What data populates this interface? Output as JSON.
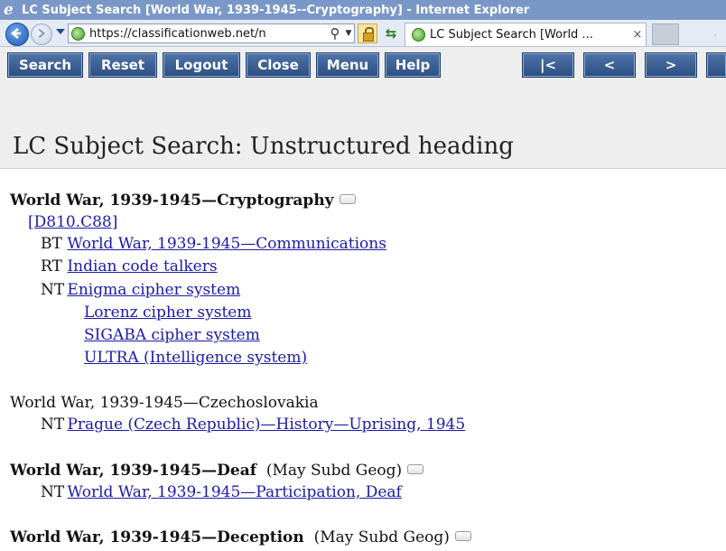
{
  "window": {
    "title": "LC Subject Search [World War, 1939-1945--Cryptography] - Internet Explorer"
  },
  "browser": {
    "url": "https://classificationweb.net/n",
    "tab_title": "LC Subject Search [World ...",
    "tab_close": "×"
  },
  "toolbar": {
    "buttons": [
      "Search",
      "Reset",
      "Logout",
      "Close",
      "Menu",
      "Help",
      "|<",
      "<",
      ">"
    ]
  },
  "page": {
    "title": "LC Subject Search: Unstructured heading"
  },
  "entries": [
    {
      "heading": "World War, 1939-1945—Cryptography",
      "class_number": "[D810.C88]",
      "bt_label": "BT",
      "bt": "World War, 1939-1945—Communications",
      "rt_label": "RT",
      "rt": "Indian code talkers",
      "nt_label": "NT",
      "nt": [
        "Enigma cipher system",
        "Lorenz cipher system",
        "SIGABA cipher system",
        "ULTRA (Intelligence system)"
      ]
    },
    {
      "heading": "World War, 1939-1945—Czechoslovakia",
      "nt_label": "NT",
      "nt": [
        "Prague (Czech Republic)—History—Uprising, 1945"
      ]
    },
    {
      "heading": "World War, 1939-1945—Deaf",
      "geo": "(May Subd Geog)",
      "nt_label": "NT",
      "nt": [
        "World War, 1939-1945—Participation, Deaf"
      ]
    },
    {
      "heading": "World War, 1939-1945—Deception",
      "geo": "(May Subd Geog)"
    }
  ],
  "colors": {
    "titlebar": "#7a98c7",
    "button": "#2c4f83",
    "link": "#1b1aa8"
  }
}
